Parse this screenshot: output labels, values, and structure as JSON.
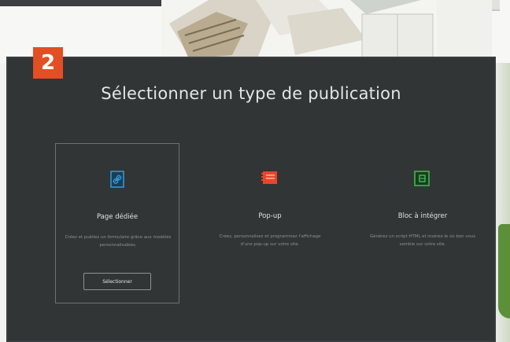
{
  "step_number": "2",
  "title": "Sélectionner un type de publication",
  "cards": [
    {
      "title": "Page dédiée",
      "description": "Créez et publiez un formulaire grâce aux modèles personnalisables.",
      "button": "Sélectionner",
      "icon": "link-page-icon",
      "color": "#2f9de0",
      "selected": true
    },
    {
      "title": "Pop-up",
      "description": "Créez, personnalisez et programmez l'affichage d'une pop-up sur votre site.",
      "icon": "popup-window-icon",
      "color": "#e8452c",
      "selected": false
    },
    {
      "title": "Bloc à intégrer",
      "description": "Générez un script HTML et insérez-le où bon vous semble sur votre site.",
      "icon": "embed-block-icon",
      "color": "#3fb84a",
      "selected": false
    }
  ],
  "colors": {
    "panel_background": "#313536",
    "badge": "#e24f24"
  }
}
